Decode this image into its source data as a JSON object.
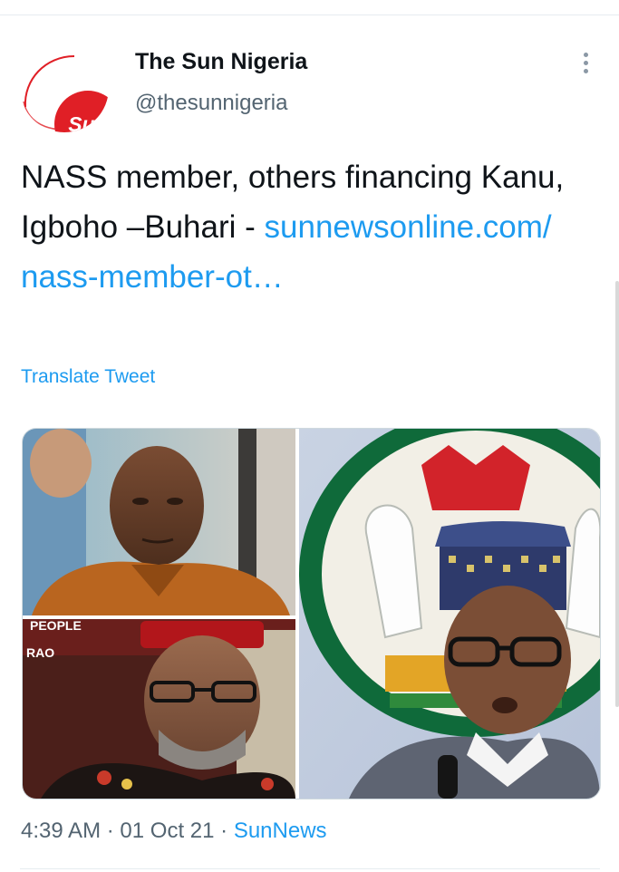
{
  "account": {
    "display_name": "The Sun Nigeria",
    "handle": "@thesunnigeria",
    "avatar_text": "Sun"
  },
  "tweet": {
    "text": "NASS member, others financing Kanu, Igboho –Buhari - ",
    "link": "sunnewsonline.com/ nass-member-ot…",
    "translate_label": "Translate Tweet",
    "time": "4:39 AM",
    "separator": "·",
    "date": "01 Oct 21",
    "source": "SunNews"
  },
  "media": {
    "image_lettering": [
      "PEOPLE",
      "RAO"
    ]
  },
  "colors": {
    "link": "#1d9bf0",
    "brand_red": "#e01f26",
    "secondary_text": "#536471",
    "border": "#cfd9de"
  },
  "icons": {
    "more": "more-vertical-icon"
  }
}
